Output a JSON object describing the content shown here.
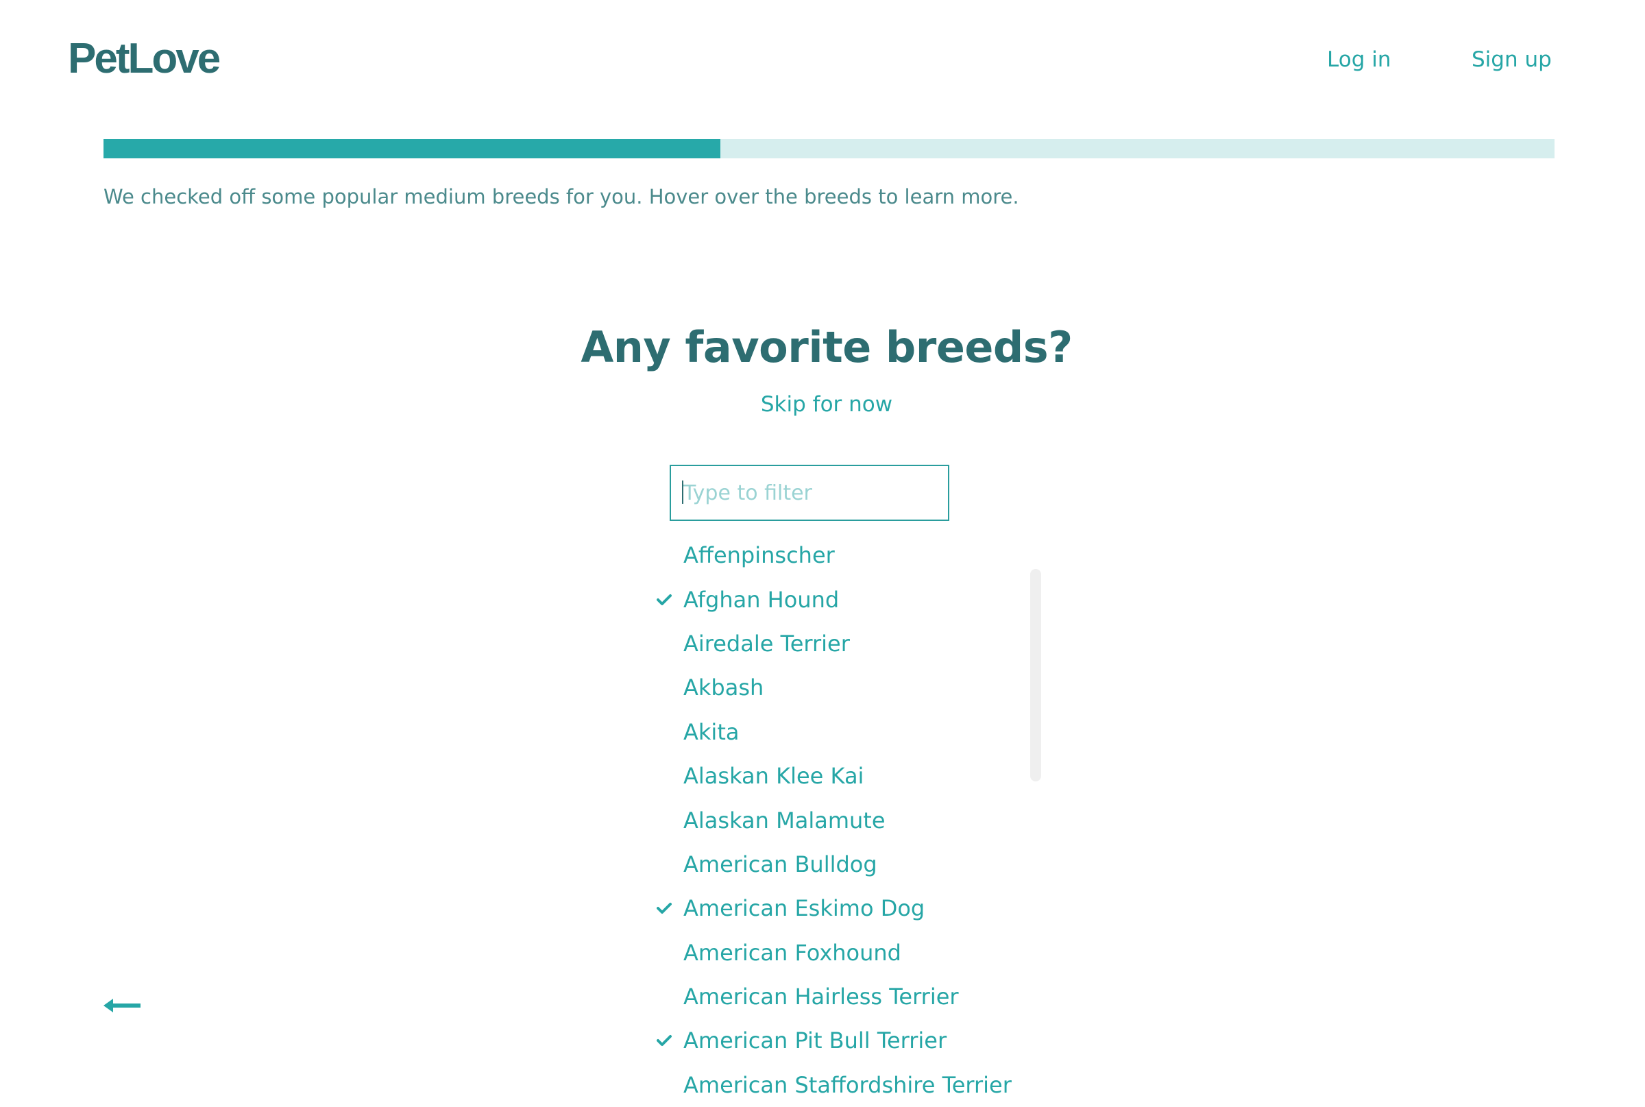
{
  "header": {
    "logo_text": "PetLove",
    "login_label": "Log in",
    "signup_label": "Sign up"
  },
  "progress": {
    "value_percent": 42.5
  },
  "hint": {
    "text": "We checked off some popular medium breeds for you. Hover over the breeds to learn more."
  },
  "main": {
    "title": "Any favorite breeds?",
    "skip_label": "Skip for now",
    "filter": {
      "placeholder": "Type to filter",
      "value": ""
    },
    "breeds": [
      {
        "name": "Affenpinscher",
        "checked": false
      },
      {
        "name": "Afghan Hound",
        "checked": true
      },
      {
        "name": "Airedale Terrier",
        "checked": false
      },
      {
        "name": "Akbash",
        "checked": false
      },
      {
        "name": "Akita",
        "checked": false
      },
      {
        "name": "Alaskan Klee Kai",
        "checked": false
      },
      {
        "name": "Alaskan Malamute",
        "checked": false
      },
      {
        "name": "American Bulldog",
        "checked": false
      },
      {
        "name": "American Eskimo Dog",
        "checked": true
      },
      {
        "name": "American Foxhound",
        "checked": false
      },
      {
        "name": "American Hairless Terrier",
        "checked": false
      },
      {
        "name": "American Pit Bull Terrier",
        "checked": true
      },
      {
        "name": "American Staffordshire Terrier",
        "checked": false
      }
    ]
  },
  "icons": {
    "check": "checkmark-icon",
    "back": "back-arrow-icon"
  },
  "colors": {
    "brand_dark": "#2d6d71",
    "accent": "#26a6a6",
    "progress_track": "#d6eeee"
  }
}
